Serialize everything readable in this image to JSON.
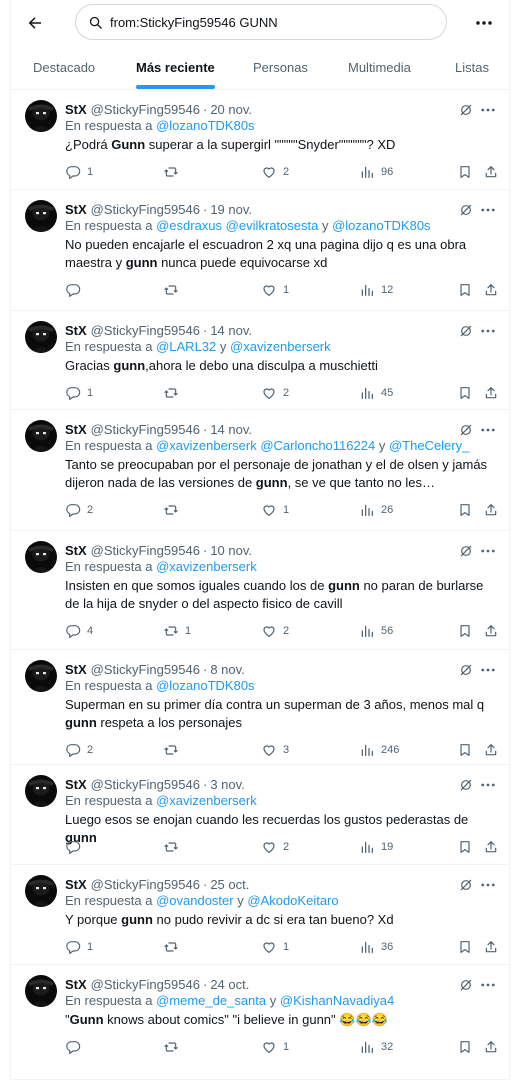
{
  "search": {
    "query": "from:StickyFing59546 GUNN"
  },
  "tabs": [
    {
      "label": "Destacado"
    },
    {
      "label": "Más reciente"
    },
    {
      "label": "Personas"
    },
    {
      "label": "Multimedia"
    },
    {
      "label": "Listas"
    }
  ],
  "active_tab": "Más reciente",
  "reply_prefix": "En respuesta a",
  "reply_joiner": "y",
  "tweets": [
    {
      "name": "StX",
      "handle": "@StickyFing59546",
      "date": "20 nov.",
      "reply_to": [
        "@lozanoTDK80s"
      ],
      "text_parts": [
        [
          "¿Podrá ",
          false
        ],
        [
          "Gunn",
          true
        ],
        [
          " superar a la supergirl \"\"\"\"\"Snyder\"\"\"\"\"\"?  XD",
          false
        ]
      ],
      "replies": "1",
      "reposts": "",
      "likes": "2",
      "views": "96"
    },
    {
      "name": "StX",
      "handle": "@StickyFing59546",
      "date": "19 nov.",
      "reply_to": [
        "@esdraxus",
        "@evilkratosesta",
        "@lozanoTDK80s"
      ],
      "text_parts": [
        [
          "No pueden encajarle el escuadron 2 xq una pagina dijo q es una obra maestra y ",
          false
        ],
        [
          "gunn",
          true
        ],
        [
          " nunca puede equivocarse xd",
          false
        ]
      ],
      "replies": "",
      "reposts": "",
      "likes": "1",
      "views": "12"
    },
    {
      "name": "StX",
      "handle": "@StickyFing59546",
      "date": "14 nov.",
      "reply_to": [
        "@LARL32",
        "@xavizenberserk"
      ],
      "text_parts": [
        [
          "Gracias ",
          false
        ],
        [
          "gunn",
          true
        ],
        [
          ",ahora le debo una disculpa a muschietti",
          false
        ]
      ],
      "replies": "1",
      "reposts": "",
      "likes": "2",
      "views": "45"
    },
    {
      "name": "StX",
      "handle": "@StickyFing59546",
      "date": "14 nov.",
      "reply_to": [
        "@xavizenberserk",
        "@Carloncho116224",
        "@TheCelery_"
      ],
      "text_parts": [
        [
          "Tanto se preocupaban por el personaje de jonathan y el de olsen y jamás dijeron nada de las versiones de ",
          false
        ],
        [
          "gunn",
          true
        ],
        [
          ", se ve que tanto no les importaban...",
          false
        ]
      ],
      "replies": "2",
      "reposts": "",
      "likes": "1",
      "views": "26"
    },
    {
      "name": "StX",
      "handle": "@StickyFing59546",
      "date": "10 nov.",
      "reply_to": [
        "@xavizenberserk"
      ],
      "text_parts": [
        [
          "Insisten en que somos iguales cuando los de ",
          false
        ],
        [
          "gunn",
          true
        ],
        [
          " no paran de burlarse de la hija de snyder o del aspecto fisico de cavill",
          false
        ]
      ],
      "replies": "4",
      "reposts": "1",
      "likes": "2",
      "views": "56"
    },
    {
      "name": "StX",
      "handle": "@StickyFing59546",
      "date": "8 nov.",
      "reply_to": [
        "@lozanoTDK80s"
      ],
      "text_parts": [
        [
          "Superman en su primer día contra un superman de 3 años, menos mal q ",
          false
        ],
        [
          "gunn",
          true
        ],
        [
          " respeta a los personajes",
          false
        ]
      ],
      "replies": "2",
      "reposts": "",
      "likes": "3",
      "views": "246"
    },
    {
      "name": "StX",
      "handle": "@StickyFing59546",
      "date": "3 nov.",
      "reply_to": [
        "@xavizenberserk"
      ],
      "text_parts": [
        [
          "Luego esos se enojan cuando les recuerdas los gustos pederastas de ",
          false
        ],
        [
          "gunn",
          true
        ]
      ],
      "replies": "",
      "reposts": "",
      "likes": "2",
      "views": "19"
    },
    {
      "name": "StX",
      "handle": "@StickyFing59546",
      "date": "25 oct.",
      "reply_to": [
        "@ovandoster",
        "@AkodoKeitaro"
      ],
      "text_parts": [
        [
          "Y porque ",
          false
        ],
        [
          "gunn",
          true
        ],
        [
          " no pudo revivir a dc si era tan bueno? Xd",
          false
        ]
      ],
      "replies": "1",
      "reposts": "",
      "likes": "1",
      "views": "36"
    },
    {
      "name": "StX",
      "handle": "@StickyFing59546",
      "date": "24 oct.",
      "reply_to": [
        "@meme_de_santa",
        "@KishanNavadiya4"
      ],
      "text_parts": [
        [
          "\"",
          false
        ],
        [
          "Gunn",
          true
        ],
        [
          " knows about comics\" \"i believe in gunn\" 😂😂😂",
          false
        ]
      ],
      "replies": "",
      "reposts": "",
      "likes": "1",
      "views": "32"
    }
  ]
}
